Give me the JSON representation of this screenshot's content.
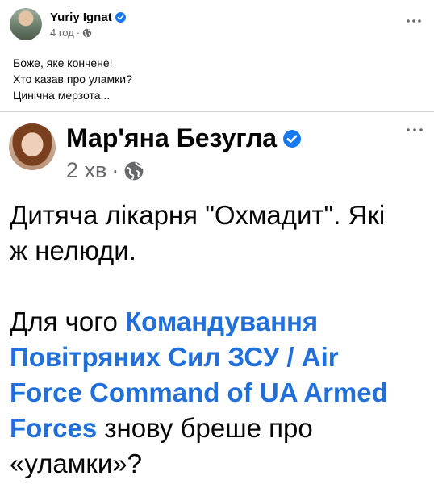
{
  "post": {
    "author": "Yuriy Ignat",
    "time": "4 год",
    "lines": [
      "Боже, яке кончене!",
      "Хто казав про уламки?",
      "Цинічна мерзота..."
    ]
  },
  "shared": {
    "author": "Мар'яна Безугла",
    "time": "2 хв",
    "paragraph1": [
      "Дитяча лікарня \"Охмадит\". Які",
      "ж нелюди."
    ],
    "p2_line1_plain": "Для чого ",
    "p2_line1_mention": "Командування",
    "p2_line2_mention": "Повітряних Сил ЗСУ / Air",
    "p2_line3_mention": "Force Command of UA Armed",
    "p2_line4_mention": "Forces",
    "p2_line4_plain": " знову бреше про",
    "p2_line5": "«уламки»?"
  },
  "colors": {
    "verified_badge": "#1877f2",
    "mention": "#216fdb",
    "meta_text": "#65676b"
  },
  "icons": {
    "verified": "verified-badge-icon",
    "audience": "globe-icon",
    "more": "more-options-icon"
  }
}
